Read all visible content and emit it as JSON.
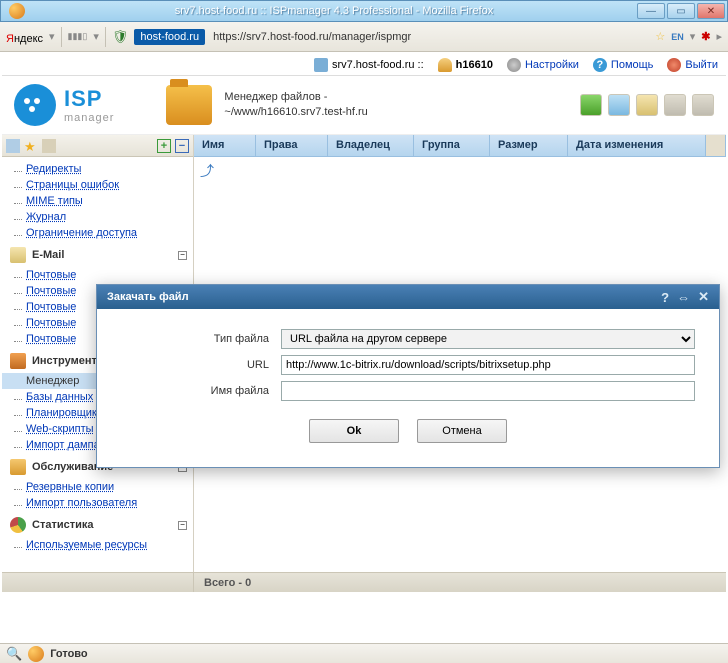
{
  "window": {
    "title": "srv7.host-food.ru :: ISPmanager 4.3 Professional - Mozilla Firefox"
  },
  "toolbar": {
    "yandex_prefix": "Я",
    "yandex_rest": "ндекс",
    "host_tag": "host-food.ru",
    "url": "https://srv7.host-food.ru/manager/ispmgr"
  },
  "topheader": {
    "server": "srv7.host-food.ru ::",
    "user": "h16610",
    "settings": "Настройки",
    "help": "Помощь",
    "logout": "Выйти"
  },
  "logo": {
    "isp": "ISP",
    "manager": "manager"
  },
  "breadcrumb": {
    "line1": "Менеджер файлов -",
    "line2": "~/www/h16610.srv7.test-hf.ru"
  },
  "columns": {
    "name": "Имя",
    "perms": "Права",
    "owner": "Владелец",
    "group": "Группа",
    "size": "Размер",
    "mtime": "Дата изменения"
  },
  "sidebar": {
    "group1": [
      "Редиректы",
      "Страницы ошибок",
      "MIME типы",
      "Журнал",
      "Ограничение доступа"
    ],
    "email_title": "E-Mail",
    "email_items": [
      "Почтовые",
      "Почтовые",
      "Почтовые",
      "Почтовые",
      "Почтовые"
    ],
    "tools_title": "Инструменты",
    "tools_items": [
      "Менеджер",
      "Базы данных",
      "Планировщик (cron)",
      "Web-скрипты",
      "Импорт дампа MySQL"
    ],
    "maint_title": "Обслуживание",
    "maint_items": [
      "Резервные копии",
      "Импорт пользователя"
    ],
    "stats_title": "Статистика",
    "stats_items": [
      "Используемые ресурсы"
    ]
  },
  "modal": {
    "title": "Закачать файл",
    "type_label": "Тип файла",
    "type_value": "URL файла на другом сервере",
    "url_label": "URL",
    "url_value": "http://www.1c-bitrix.ru/download/scripts/bitrixsetup.php",
    "name_label": "Имя файла",
    "name_value": "",
    "ok": "Ok",
    "cancel": "Отмена"
  },
  "status": {
    "total": "Всего - 0",
    "ff": "Готово"
  }
}
